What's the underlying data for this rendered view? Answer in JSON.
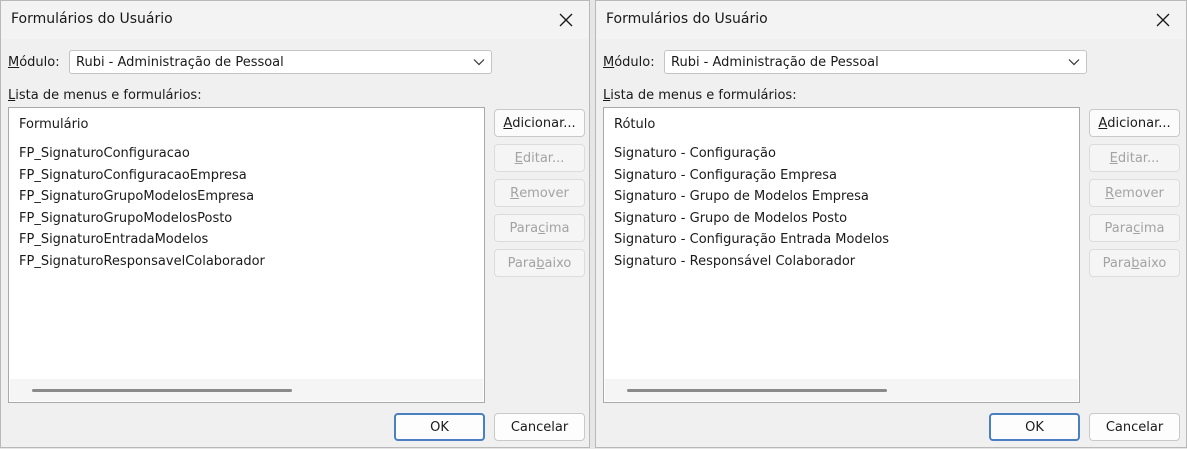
{
  "dialogs": [
    {
      "title": "Formulários do Usuário",
      "module_label": "Módulo:",
      "module_value": "Rubi - Administração de Pessoal",
      "list_label": "Lista de menus e formulários:",
      "list_header": "Formulário",
      "items": [
        "FP_SignaturoConfiguracao",
        "FP_SignaturoConfiguracaoEmpresa",
        "FP_SignaturoGrupoModelosEmpresa",
        "FP_SignaturoGrupoModelosPosto",
        "FP_SignaturoEntradaModelos",
        "FP_SignaturoResponsavelColaborador"
      ],
      "buttons": {
        "add": {
          "pre": "",
          "key": "A",
          "post": "dicionar..."
        },
        "edit": {
          "pre": "",
          "key": "E",
          "post": "ditar..."
        },
        "remove": {
          "pre": "",
          "key": "R",
          "post": "emover"
        },
        "up": {
          "pre": "Para ",
          "key": "c",
          "post": "ima"
        },
        "down": {
          "pre": "Para ",
          "key": "b",
          "post": "aixo"
        },
        "ok": "OK",
        "cancel": "Cancelar"
      }
    },
    {
      "title": "Formulários do Usuário",
      "module_label": "Módulo:",
      "module_value": "Rubi - Administração de Pessoal",
      "list_label": "Lista de menus e formulários:",
      "list_header": "Rótulo",
      "items": [
        "Signaturo - Configuração",
        "Signaturo - Configuração Empresa",
        "Signaturo - Grupo de Modelos Empresa",
        "Signaturo - Grupo de Modelos Posto",
        "Signaturo - Configuração Entrada Modelos",
        "Signaturo - Responsável Colaborador"
      ],
      "buttons": {
        "add": {
          "pre": "",
          "key": "A",
          "post": "dicionar..."
        },
        "edit": {
          "pre": "",
          "key": "E",
          "post": "ditar..."
        },
        "remove": {
          "pre": "",
          "key": "R",
          "post": "emover"
        },
        "up": {
          "pre": "Para ",
          "key": "c",
          "post": "ima"
        },
        "down": {
          "pre": "Para ",
          "key": "b",
          "post": "aixo"
        },
        "ok": "OK",
        "cancel": "Cancelar"
      }
    }
  ],
  "icons": {
    "close": "close-icon",
    "dropdown": "chevron-down-icon"
  },
  "colors": {
    "ok_border": "#4a7fc0",
    "disabled_text": "#a3a3a3"
  }
}
